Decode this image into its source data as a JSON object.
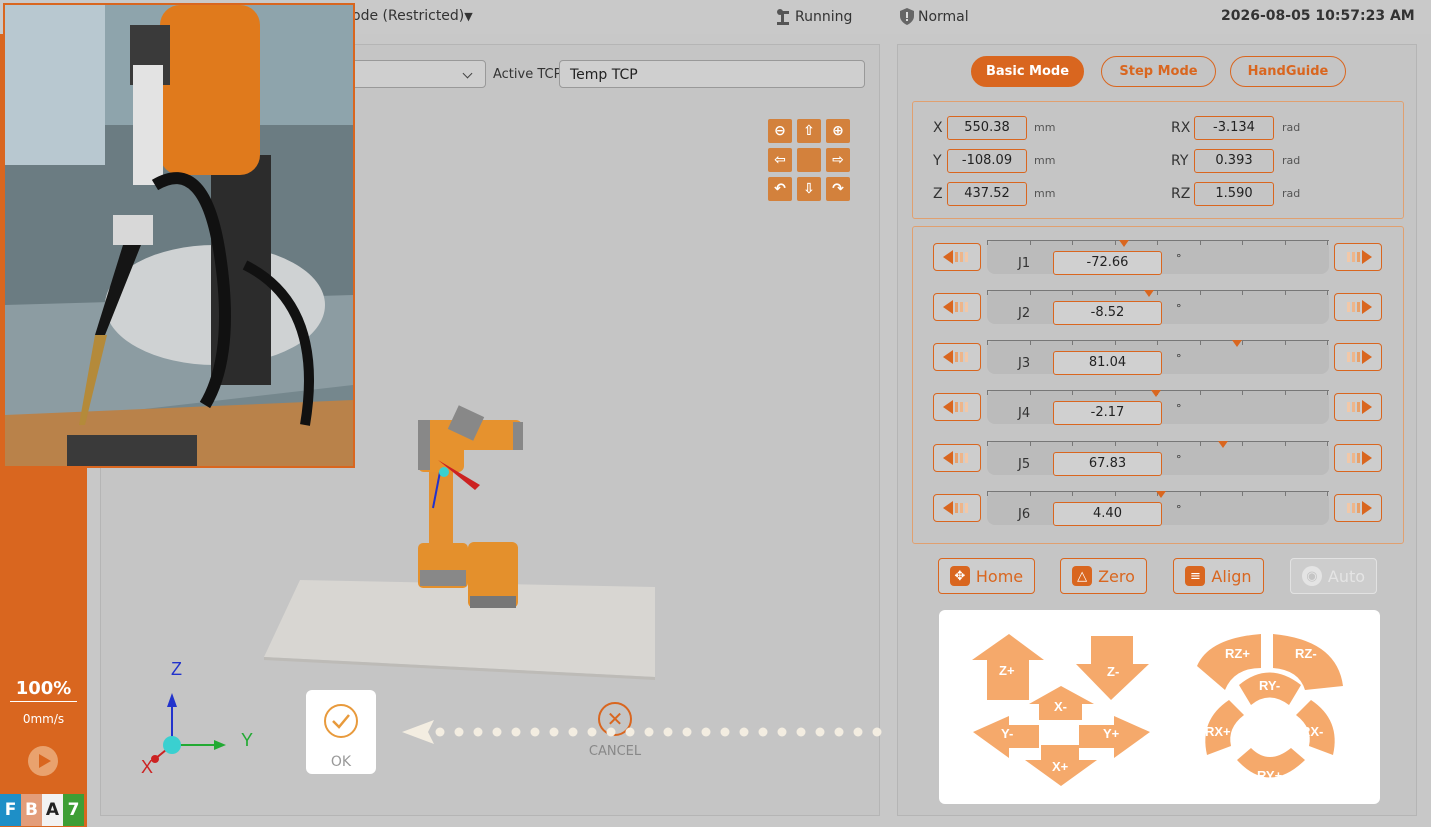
{
  "topbar": {
    "mode": "ode (Restricted)",
    "robot_status": "Running",
    "safety_status": "Normal",
    "datetime": "2026-08-05 10:57:23 AM"
  },
  "sidebar": {
    "speed_percent": "100%",
    "speed_mm": "0mm/s",
    "badges": [
      {
        "letter": "F",
        "color": "#1e8fc7"
      },
      {
        "letter": "B",
        "color": "#e39d7a"
      },
      {
        "letter": "A",
        "color": "#f2f2f2"
      },
      {
        "letter": "7",
        "color": "#3e9e35"
      }
    ]
  },
  "tcp": {
    "active_label": "Active TCP",
    "active_value": "Temp TCP"
  },
  "axes": {
    "z": "Z",
    "y": "Y",
    "x": "X"
  },
  "dialog": {
    "ok": "OK",
    "cancel": "CANCEL"
  },
  "modes": {
    "basic": "Basic Mode",
    "step": "Step Mode",
    "handguide": "HandGuide"
  },
  "coords": {
    "x": {
      "label": "X",
      "value": "550.38",
      "unit": "mm"
    },
    "y": {
      "label": "Y",
      "value": "-108.09",
      "unit": "mm"
    },
    "z": {
      "label": "Z",
      "value": "437.52",
      "unit": "mm"
    },
    "rx": {
      "label": "RX",
      "value": "-3.134",
      "unit": "rad"
    },
    "ry": {
      "label": "RY",
      "value": "0.393",
      "unit": "rad"
    },
    "rz": {
      "label": "RZ",
      "value": "1.590",
      "unit": "rad"
    }
  },
  "joints": [
    {
      "name": "J1",
      "value": "-72.66",
      "unit": "°",
      "marker_fraction": 0.4
    },
    {
      "name": "J2",
      "value": "-8.52",
      "unit": "°",
      "marker_fraction": 0.475
    },
    {
      "name": "J3",
      "value": "81.04",
      "unit": "°",
      "marker_fraction": 0.73
    },
    {
      "name": "J4",
      "value": "-2.17",
      "unit": "°",
      "marker_fraction": 0.495
    },
    {
      "name": "J5",
      "value": "67.83",
      "unit": "°",
      "marker_fraction": 0.69
    },
    {
      "name": "J6",
      "value": "4.40",
      "unit": "°",
      "marker_fraction": 0.51
    }
  ],
  "actions": {
    "home": "Home",
    "zero": "Zero",
    "align": "Align",
    "auto": "Auto"
  },
  "jog": {
    "zplus": "Z+",
    "zminus": "Z-",
    "xminus": "X-",
    "xplus": "X+",
    "yminus": "Y-",
    "yplus": "Y+",
    "rzplus": "RZ+",
    "rzminus": "RZ-",
    "ryminus": "RY-",
    "ryplus": "RY+",
    "rxplus": "RX+",
    "rxminus": "RX-"
  },
  "colors": {
    "accent": "#d9661f",
    "jog_arrow": "#f5a96b"
  }
}
